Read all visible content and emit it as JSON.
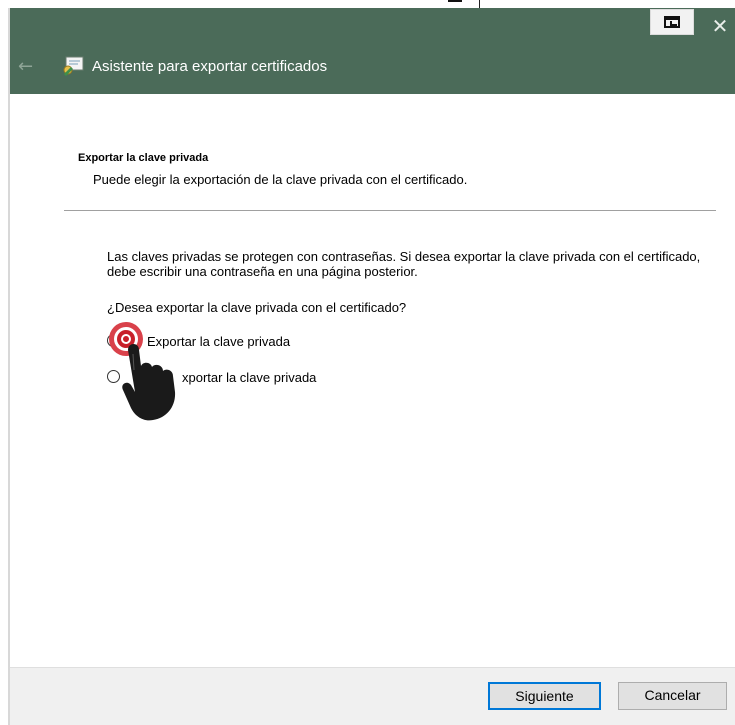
{
  "window": {
    "title": "Asistente para exportar certificados",
    "close_glyph": "✕",
    "back_glyph": "←"
  },
  "content": {
    "section_title": "Exportar la clave privada",
    "section_subtitle": "Puede elegir la exportación de la clave privada con el certificado.",
    "paragraph": "Las claves privadas se protegen con contraseñas. Si desea exportar la clave privada con el certificado, debe escribir una contraseña en una página posterior.",
    "question": "¿Desea exportar la clave privada con el certificado?",
    "options": [
      {
        "label": "Exportar la clave privada",
        "selected": false
      },
      {
        "label": "xportar la clave privada",
        "selected": false
      }
    ]
  },
  "footer": {
    "next_label": "Siguiente",
    "cancel_label": "Cancelar"
  },
  "colors": {
    "titlebar": "#4b6b59",
    "accent_focus": "#0078d7",
    "click_indicator": "#c8202a"
  },
  "icons": [
    "restore-icon",
    "close-icon",
    "back-arrow-icon",
    "certificate-icon",
    "click-indicator-icon",
    "pointer-hand-icon"
  ]
}
